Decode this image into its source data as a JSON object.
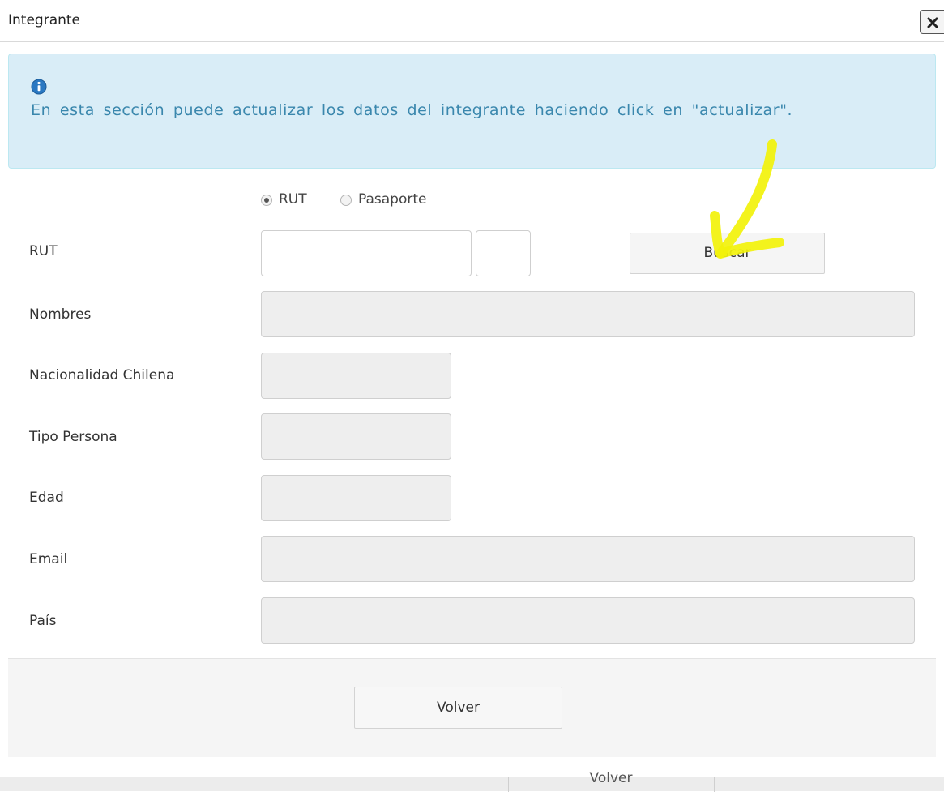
{
  "dialog": {
    "title": "Integrante",
    "close_icon": "close-icon"
  },
  "alert": {
    "icon": "info-icon",
    "text": "En esta sección puede actualizar los datos del integrante haciendo click en \"actualizar\".",
    "background": "#d9edf7",
    "text_color": "#3a87ad"
  },
  "id_type": {
    "options": [
      {
        "label": "RUT",
        "selected": true
      },
      {
        "label": "Pasaporte",
        "selected": false
      }
    ]
  },
  "form": {
    "rut": {
      "label": "RUT",
      "value": "",
      "dv_value": ""
    },
    "search_button": "Buscar",
    "nombres": {
      "label": "Nombres",
      "value": ""
    },
    "nacionalidad": {
      "label": "Nacionalidad Chilena",
      "value": ""
    },
    "tipo_persona": {
      "label": "Tipo Persona",
      "value": ""
    },
    "edad": {
      "label": "Edad",
      "value": ""
    },
    "email": {
      "label": "Email",
      "value": ""
    },
    "pais": {
      "label": "País",
      "value": ""
    }
  },
  "footer": {
    "back_button": "Volver"
  },
  "background_page": {
    "button_text": "Volver"
  },
  "annotation": {
    "type": "arrow",
    "color": "#f2f20a"
  }
}
